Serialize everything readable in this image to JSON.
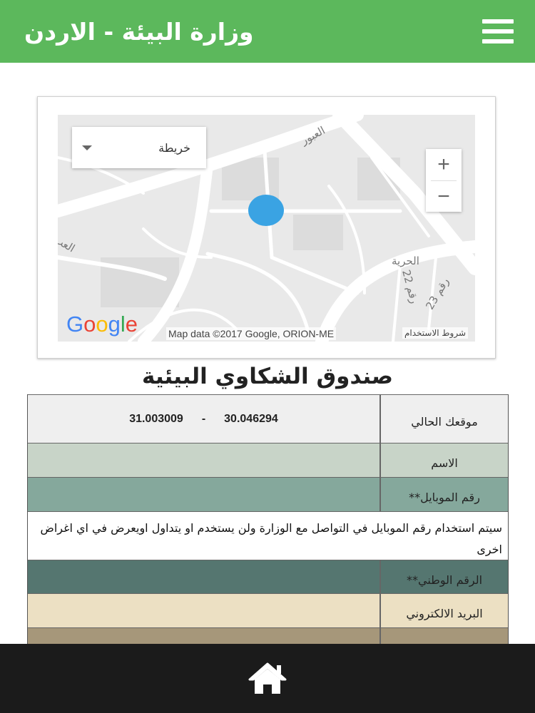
{
  "header": {
    "title": "وزارة البيئة - الاردن",
    "menu_icon": "hamburger-menu-icon",
    "color": "#5cb85c"
  },
  "map": {
    "map_type_label": "خريطة",
    "zoom_in": "+",
    "zoom_out": "−",
    "attribution": "Map data ©2017 Google, ORION-ME",
    "terms": "شروط الاستخدام",
    "logo_parts": [
      "G",
      "o",
      "o",
      "g",
      "l",
      "e"
    ],
    "streets": [
      "العبور",
      "الحرية",
      "رقم 22",
      "رقم 23",
      "العب"
    ],
    "location_dot_color": "#3aa3e3"
  },
  "complaints": {
    "title": "صندوق الشكاوي البيئية",
    "current_location_label": "موقعك الحالي",
    "latitude": "30.046294",
    "separator": "-",
    "longitude": "31.003009",
    "name_label": "الاسم",
    "mobile_label": "رقم الموبايل**",
    "mobile_note": "سيتم استخدام رقم الموبايل في التواصل مع الوزارة ولن يستخدم او يتداول اويعرض في اي اغراض اخرى",
    "national_id_label": "الرقم الوطني**",
    "email_label": "البريد الالكتروني",
    "row_colors": [
      "#efefef",
      "#c8d4c8",
      "#85a89c",
      "#557670",
      "#ece0c3",
      "#a6977a"
    ]
  },
  "bottom": {
    "home_icon": "home-icon"
  }
}
